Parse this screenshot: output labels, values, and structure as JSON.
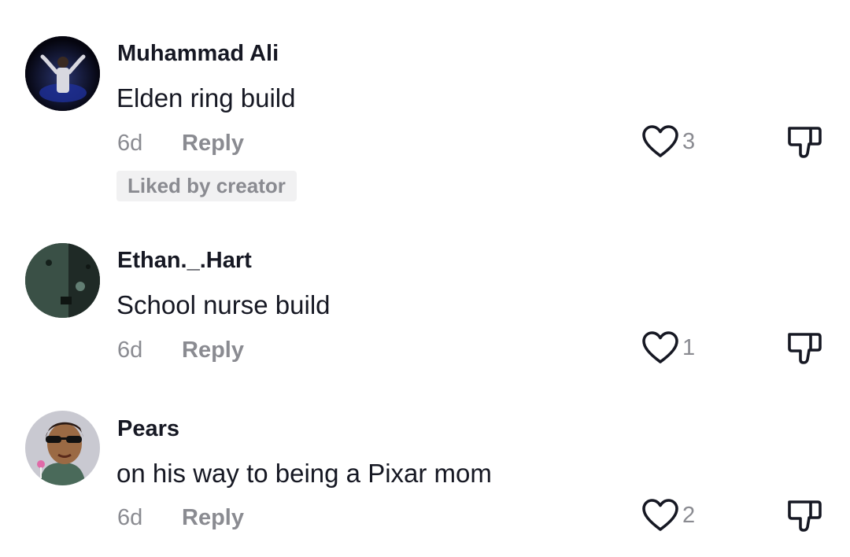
{
  "comments": [
    {
      "username": "Muhammad Ali",
      "text": "Elden ring build",
      "age": "6d",
      "reply_label": "Reply",
      "likes": "3",
      "badge": "Liked by creator",
      "avatar_icon": "person-photo-avatar"
    },
    {
      "username": "Ethan._.Hart",
      "text": "School nurse build",
      "age": "6d",
      "reply_label": "Reply",
      "likes": "1",
      "avatar_icon": "dark-photo-avatar"
    },
    {
      "username": "Pears",
      "text": "on his way to being a Pixar mom",
      "age": "6d",
      "reply_label": "Reply",
      "likes": "2",
      "avatar_icon": "cartoon-avatar"
    }
  ],
  "icons": {
    "like": "heart-outline-icon",
    "dislike": "thumbs-down-icon"
  },
  "colors": {
    "primary_text": "#161823",
    "secondary_text": "#8a8b91",
    "badge_bg": "#f1f1f2"
  }
}
